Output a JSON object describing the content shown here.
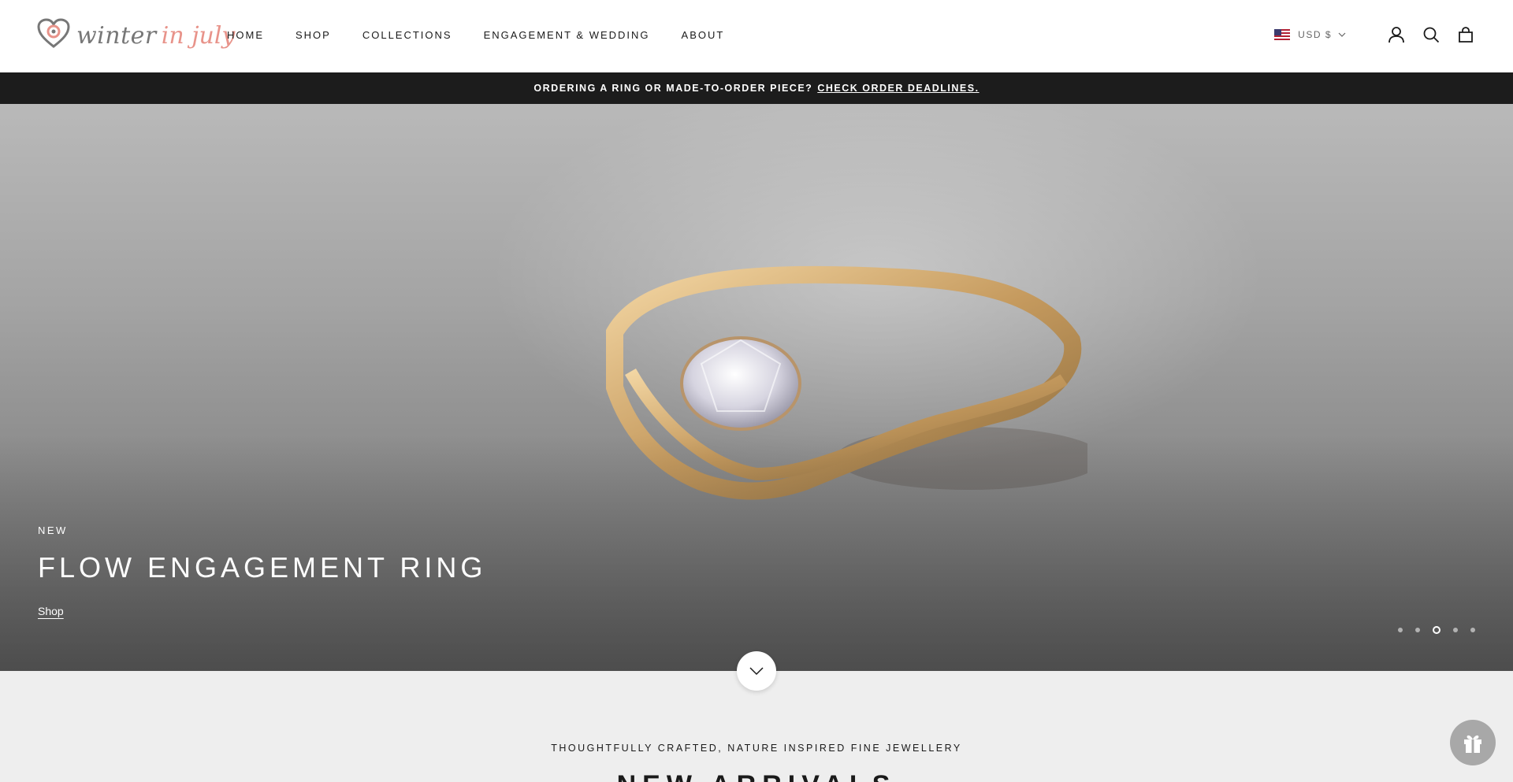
{
  "brand": {
    "name_primary": "winter",
    "name_accent": "in july"
  },
  "nav": {
    "items": [
      {
        "label": "HOME"
      },
      {
        "label": "SHOP"
      },
      {
        "label": "COLLECTIONS"
      },
      {
        "label": "ENGAGEMENT & WEDDING"
      },
      {
        "label": "ABOUT"
      }
    ]
  },
  "header": {
    "currency": "USD $"
  },
  "announcement": {
    "text": "ORDERING A RING OR MADE-TO-ORDER PIECE?",
    "link": "CHECK ORDER DEADLINES."
  },
  "hero": {
    "kicker": "NEW",
    "title": "FLOW ENGAGEMENT RING",
    "link": "Shop",
    "slide_count": 5,
    "active_slide": 3
  },
  "section": {
    "tagline": "THOUGHTFULLY CRAFTED, NATURE INSPIRED FINE JEWELLERY",
    "title": "NEW ARRIVALS"
  },
  "colors": {
    "accent": "#e8938a",
    "announcement_bg": "#1c1c1c",
    "page_bg": "#eeeeee"
  },
  "icons": [
    "logo-heart-icon",
    "flag-us-icon",
    "chevron-down-icon",
    "account-icon",
    "search-icon",
    "cart-icon",
    "scroll-down-icon",
    "gift-icon"
  ]
}
